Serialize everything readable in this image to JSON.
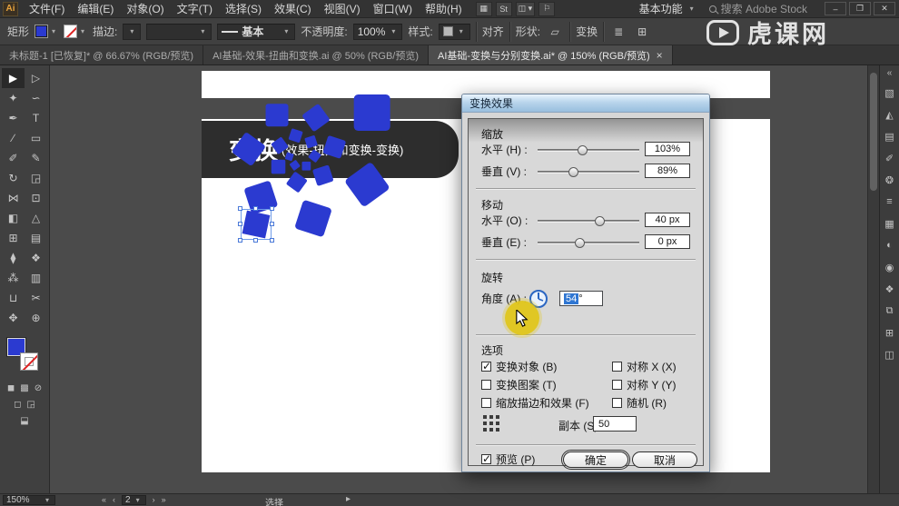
{
  "colors": {
    "artwork_blue": "#2b3ad0",
    "selection_blue": "#2f76d2",
    "highlight_yellow": "#e0c61a"
  },
  "menubar": {
    "logo": "Ai",
    "items": [
      "文件(F)",
      "编辑(E)",
      "对象(O)",
      "文字(T)",
      "选择(S)",
      "效果(C)",
      "视图(V)",
      "窗口(W)",
      "帮助(H)"
    ],
    "icons": [
      {
        "name": "bridge-icon",
        "glyph": "▦"
      },
      {
        "name": "adobe-stock-icon",
        "glyph": "St"
      },
      {
        "name": "arrange-documents-icon",
        "glyph": "◫ ▾"
      },
      {
        "name": "announcement-icon",
        "glyph": "⚐"
      }
    ],
    "workspace": "基本功能",
    "search": "搜索 Adobe Stock"
  },
  "toolbar": {
    "tool_label": "矩形",
    "stroke_label": "描边:",
    "line_style": "基本",
    "opacity_label": "不透明度:",
    "opacity_value": "100%",
    "style_label": "样式:",
    "align_label": "对齐",
    "shape_label": "形状:",
    "transform_label": "变换",
    "shape_icon": "▱",
    "menu_icon": "≣",
    "grid_icon": "⊞"
  },
  "tabs": [
    {
      "label": "未标题-1 [已恢复]* @ 66.67% (RGB/预览)",
      "active": false
    },
    {
      "label": "AI基础-效果-扭曲和变换.ai @ 50% (RGB/预览)",
      "active": false
    },
    {
      "label": "AI基础-变换与分别变换.ai* @ 150% (RGB/预览)",
      "active": true
    }
  ],
  "tools": [
    {
      "name": "selection-tool",
      "glyph": "▶",
      "active": true
    },
    {
      "name": "direct-selection-tool",
      "glyph": "▷"
    },
    {
      "name": "magic-wand-tool",
      "glyph": "✦"
    },
    {
      "name": "lasso-tool",
      "glyph": "∽"
    },
    {
      "name": "pen-tool",
      "glyph": "✒"
    },
    {
      "name": "type-tool",
      "glyph": "T"
    },
    {
      "name": "line-segment-tool",
      "glyph": "∕"
    },
    {
      "name": "rectangle-tool",
      "glyph": "▭"
    },
    {
      "name": "paintbrush-tool",
      "glyph": "✐"
    },
    {
      "name": "pencil-tool",
      "glyph": "✎"
    },
    {
      "name": "rotate-tool",
      "glyph": "↻"
    },
    {
      "name": "scale-tool",
      "glyph": "◲"
    },
    {
      "name": "width-tool",
      "glyph": "⋈"
    },
    {
      "name": "free-transform-tool",
      "glyph": "⊡"
    },
    {
      "name": "shape-builder-tool",
      "glyph": "◧"
    },
    {
      "name": "perspective-grid-tool",
      "glyph": "△"
    },
    {
      "name": "mesh-tool",
      "glyph": "⊞"
    },
    {
      "name": "gradient-tool",
      "glyph": "▤"
    },
    {
      "name": "eyedropper-tool",
      "glyph": "⧫"
    },
    {
      "name": "blend-tool",
      "glyph": "❖"
    },
    {
      "name": "symbol-sprayer-tool",
      "glyph": "⁂"
    },
    {
      "name": "column-graph-tool",
      "glyph": "▥"
    },
    {
      "name": "artboard-tool",
      "glyph": "⊔"
    },
    {
      "name": "slice-tool",
      "glyph": "✂"
    },
    {
      "name": "hand-tool",
      "glyph": "✥"
    },
    {
      "name": "zoom-tool",
      "glyph": "⊕"
    }
  ],
  "dock": [
    {
      "name": "color-panel-icon",
      "glyph": "▧"
    },
    {
      "name": "color-guide-panel-icon",
      "glyph": "◭"
    },
    {
      "name": "swatches-panel-icon",
      "glyph": "▤"
    },
    {
      "name": "brushes-panel-icon",
      "glyph": "✐"
    },
    {
      "name": "symbols-panel-icon",
      "glyph": "❂"
    },
    {
      "name": "stroke-panel-icon",
      "glyph": "≡"
    },
    {
      "name": "gradient-panel-icon",
      "glyph": "▦"
    },
    {
      "name": "transparency-panel-icon",
      "glyph": "◐"
    },
    {
      "name": "appearance-panel-icon",
      "glyph": "◉"
    },
    {
      "name": "graphic-styles-panel-icon",
      "glyph": "❖"
    },
    {
      "name": "layers-panel-icon",
      "glyph": "⧉"
    },
    {
      "name": "artboards-panel-icon",
      "glyph": "⊞"
    },
    {
      "name": "libraries-panel-icon",
      "glyph": "◫"
    }
  ],
  "canvas": {
    "banner_big": "变换",
    "banner_small": "(效果-扭曲和变换-变换)"
  },
  "dialog": {
    "title": "变换效果",
    "scale": {
      "header": "缩放",
      "rows": [
        {
          "label": "水平 (H) :",
          "value": "103%",
          "pos": 0.44
        },
        {
          "label": "垂直 (V) :",
          "value": "89%",
          "pos": 0.35
        }
      ]
    },
    "move": {
      "header": "移动",
      "rows": [
        {
          "label": "水平 (O) :",
          "value": "40 px",
          "pos": 0.61
        },
        {
          "label": "垂直 (E) :",
          "value": "0 px",
          "pos": 0.41
        }
      ]
    },
    "rotate": {
      "header": "旋转",
      "angle_label": "角度 (A) :",
      "angle_value": "54",
      "angle_unit": "°"
    },
    "options": {
      "header": "选项",
      "left": [
        {
          "label": "变换对象 (B)",
          "checked": true
        },
        {
          "label": "变换图案 (T)",
          "checked": false
        },
        {
          "label": "缩放描边和效果 (F)",
          "checked": false
        }
      ],
      "right": [
        {
          "label": "对称 X (X)",
          "checked": false
        },
        {
          "label": "对称 Y (Y)",
          "checked": false
        },
        {
          "label": "随机 (R)",
          "checked": false
        }
      ],
      "copies_label": "副本 (S)",
      "copies_value": "50"
    },
    "preview_label": "预览 (P)",
    "preview_checked": true,
    "ok_label": "确定",
    "cancel_label": "取消"
  },
  "statusbar": {
    "zoom": "150%",
    "artboard": "2",
    "tool": "选择"
  },
  "watermark": "虎课网"
}
